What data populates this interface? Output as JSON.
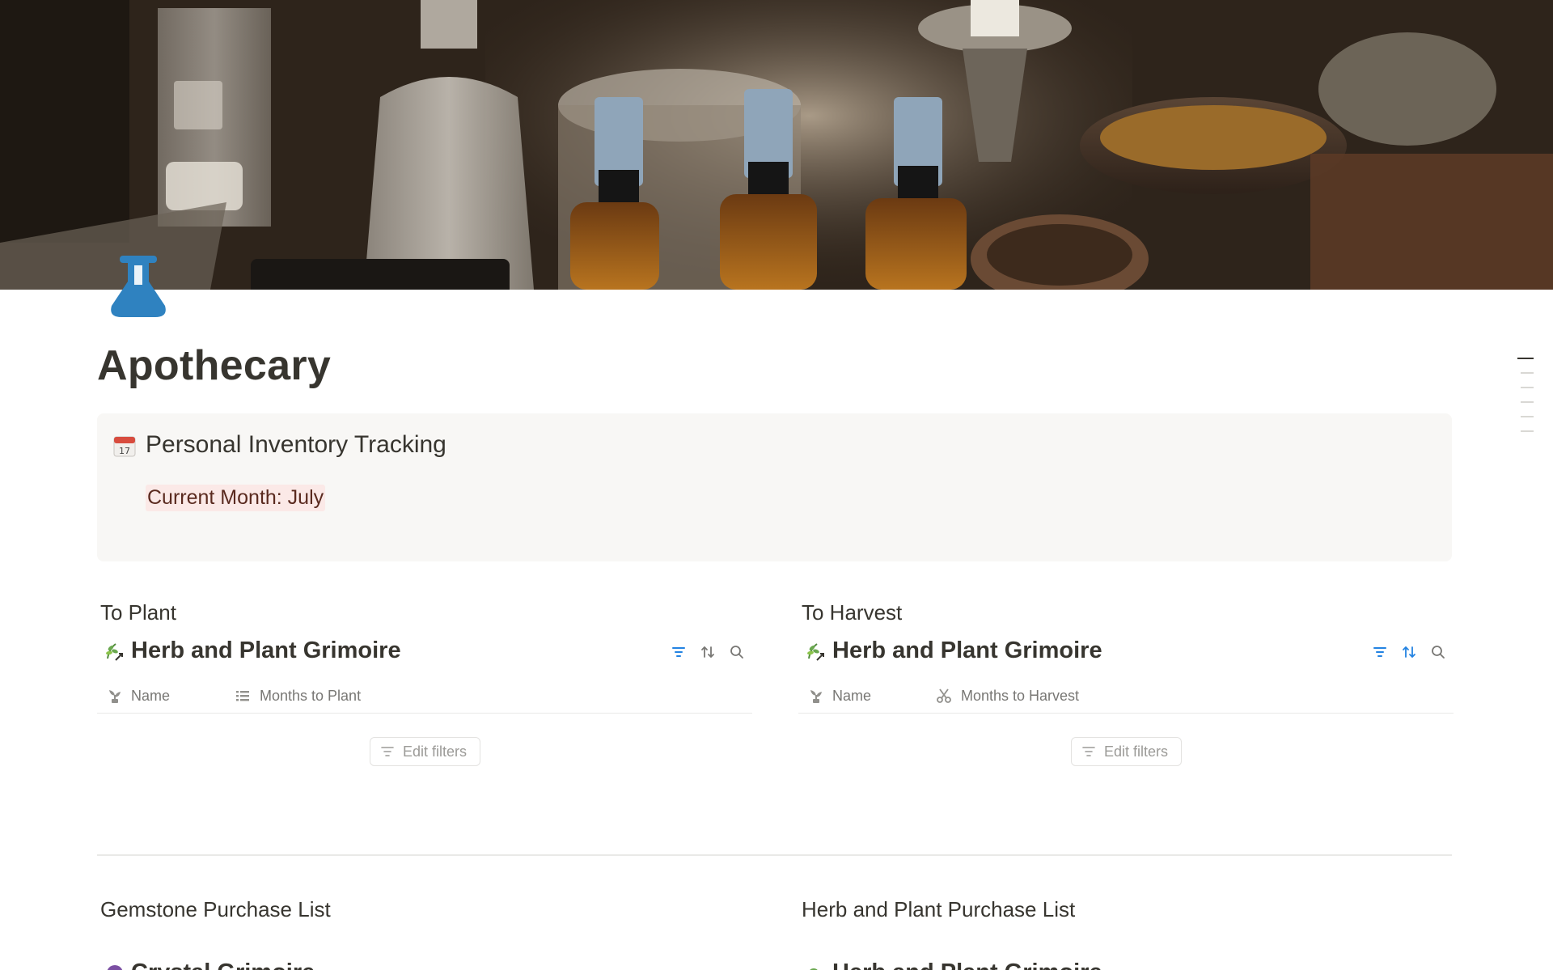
{
  "page": {
    "title": "Apothecary",
    "icon": "flask-icon",
    "cover": "apothecary-bottles-herbs-cover-image"
  },
  "callout": {
    "icon": "calendar-icon",
    "title": "Personal Inventory Tracking",
    "subtitle": "Current Month: July"
  },
  "colors": {
    "text": "#37352f",
    "muted": "#787774",
    "accent_blue": "#2383e2",
    "icon_blue": "#2f82c0",
    "callout_bg": "#f8f7f5",
    "highlight_bg": "#fbe9e7"
  },
  "to_plant": {
    "section_label": "To Plant",
    "db_title": "Herb and Plant Grimoire",
    "db_icon": "herb-icon",
    "columns": [
      {
        "label": "Name",
        "icon": "sprout-icon"
      },
      {
        "label": "Months to Plant",
        "icon": "list-icon"
      }
    ],
    "edit_filters_label": "Edit filters",
    "tools": [
      "filter-icon",
      "sort-icon",
      "search-icon"
    ]
  },
  "to_harvest": {
    "section_label": "To Harvest",
    "db_title": "Herb and Plant Grimoire",
    "db_icon": "herb-icon",
    "columns": [
      {
        "label": "Name",
        "icon": "sprout-icon"
      },
      {
        "label": "Months to Harvest",
        "icon": "scissors-icon"
      }
    ],
    "edit_filters_label": "Edit filters",
    "tools": [
      "filter-icon",
      "sort-icon",
      "search-icon"
    ]
  },
  "gemstone_purchase": {
    "section_label": "Gemstone Purchase List",
    "db_title_partial": "Crystal Grimoire"
  },
  "herb_purchase": {
    "section_label": "Herb and Plant Purchase List",
    "db_title_partial": "Herb and Plant Grimoire"
  }
}
